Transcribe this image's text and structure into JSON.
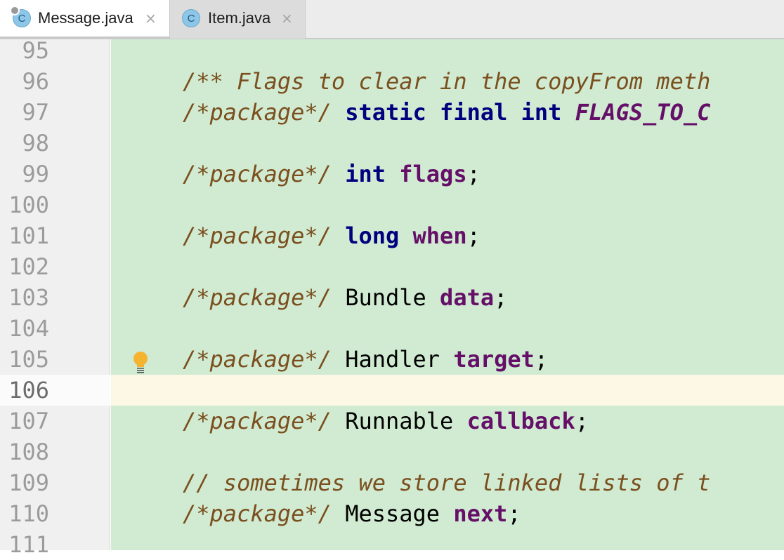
{
  "tabs": [
    {
      "label": "Message.java",
      "icon": "class-icon",
      "icon_letter": "C",
      "active": true
    },
    {
      "label": "Item.java",
      "icon": "class-icon",
      "icon_letter": "C",
      "active": false
    }
  ],
  "tab_close_glyph": "×",
  "colors": {
    "code_background": "#d0ebd2",
    "current_line": "#fdf7e6",
    "comment": "#7b4f1e",
    "keyword": "#00007f",
    "field": "#650f68"
  },
  "editor": {
    "current_line": 106,
    "lines": [
      {
        "num": "95",
        "tokens": []
      },
      {
        "num": "96",
        "tokens": [
          {
            "t": "cmt",
            "v": "/** Flags to clear in the copyFrom meth"
          }
        ]
      },
      {
        "num": "97",
        "tokens": [
          {
            "t": "cmt",
            "v": "/*package*/"
          },
          {
            "t": "plain",
            "v": " "
          },
          {
            "t": "kw",
            "v": "static final int"
          },
          {
            "t": "plain",
            "v": " "
          },
          {
            "t": "cst",
            "v": "FLAGS_TO_C"
          }
        ]
      },
      {
        "num": "98",
        "tokens": []
      },
      {
        "num": "99",
        "tokens": [
          {
            "t": "cmt",
            "v": "/*package*/"
          },
          {
            "t": "plain",
            "v": " "
          },
          {
            "t": "kw",
            "v": "int"
          },
          {
            "t": "plain",
            "v": " "
          },
          {
            "t": "fld",
            "v": "flags"
          },
          {
            "t": "plain",
            "v": ";"
          }
        ]
      },
      {
        "num": "100",
        "tokens": []
      },
      {
        "num": "101",
        "tokens": [
          {
            "t": "cmt",
            "v": "/*package*/"
          },
          {
            "t": "plain",
            "v": " "
          },
          {
            "t": "kw",
            "v": "long"
          },
          {
            "t": "plain",
            "v": " "
          },
          {
            "t": "fld",
            "v": "when"
          },
          {
            "t": "plain",
            "v": ";"
          }
        ]
      },
      {
        "num": "102",
        "tokens": []
      },
      {
        "num": "103",
        "tokens": [
          {
            "t": "cmt",
            "v": "/*package*/"
          },
          {
            "t": "plain",
            "v": " Bundle "
          },
          {
            "t": "fld",
            "v": "data"
          },
          {
            "t": "plain",
            "v": ";"
          }
        ]
      },
      {
        "num": "104",
        "tokens": []
      },
      {
        "num": "105",
        "tokens": [
          {
            "t": "cmt",
            "v": "/*package*/"
          },
          {
            "t": "plain",
            "v": " Handler "
          },
          {
            "t": "fld",
            "v": "target"
          },
          {
            "t": "plain",
            "v": ";"
          }
        ],
        "marker": "intention-bulb-icon"
      },
      {
        "num": "106",
        "tokens": []
      },
      {
        "num": "107",
        "tokens": [
          {
            "t": "cmt",
            "v": "/*package*/"
          },
          {
            "t": "plain",
            "v": " Runnable "
          },
          {
            "t": "fld",
            "v": "callback"
          },
          {
            "t": "plain",
            "v": ";"
          }
        ]
      },
      {
        "num": "108",
        "tokens": []
      },
      {
        "num": "109",
        "tokens": [
          {
            "t": "cmt",
            "v": "// sometimes we store linked lists of t"
          }
        ]
      },
      {
        "num": "110",
        "tokens": [
          {
            "t": "cmt",
            "v": "/*package*/"
          },
          {
            "t": "plain",
            "v": " Message "
          },
          {
            "t": "fld",
            "v": "next"
          },
          {
            "t": "plain",
            "v": ";"
          }
        ]
      },
      {
        "num": "111",
        "tokens": []
      }
    ]
  }
}
